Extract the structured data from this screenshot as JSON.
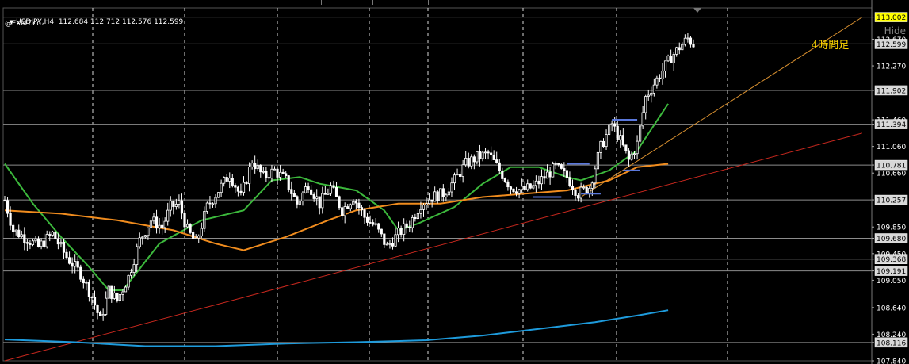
{
  "header": {
    "symbol": "USDJPY,H4",
    "ohlc": "112.684 112.712 112.576 112.599",
    "watermark": "@FXMT.co"
  },
  "hide_label": "Hide",
  "annotation": "4時間足",
  "colors": {
    "bg": "#000000",
    "grid": "#ffffff",
    "candles": "#ffffff",
    "ma_green": "#3cb83c",
    "ma_orange": "#f08c1e",
    "ma_blue": "#1e9bdc",
    "trend_red": "#c8281e",
    "trend_orange": "#d89030",
    "hline": "#8c8c8c",
    "level_blue": "#5a78dc",
    "price_tag_bg": "#ffffff",
    "price_tag_yellow": "#ffff00"
  },
  "chart_data": {
    "type": "candlestick",
    "title": "USDJPY,H4",
    "ylim": [
      107.84,
      113.14
    ],
    "y_ticks": [
      "113.002",
      "112.670",
      "112.599",
      "112.270",
      "111.902",
      "111.460",
      "111.394",
      "111.060",
      "110.781",
      "110.660",
      "110.257",
      "109.850",
      "109.680",
      "109.450",
      "109.368",
      "109.191",
      "109.050",
      "108.640",
      "108.240",
      "108.116",
      "107.840"
    ],
    "current_price": 112.599,
    "alert_price": 113.002,
    "horizontal_levels": [
      113.002,
      112.599,
      111.902,
      111.394,
      110.781,
      110.257,
      109.68,
      109.368,
      109.191,
      108.116
    ],
    "candle_count": 255,
    "close_path": [
      [
        0,
        110.25
      ],
      [
        3,
        109.8
      ],
      [
        7,
        109.7
      ],
      [
        12,
        109.55
      ],
      [
        17,
        109.75
      ],
      [
        22,
        109.4
      ],
      [
        27,
        109.15
      ],
      [
        31,
        108.8
      ],
      [
        34,
        108.45
      ],
      [
        37,
        108.9
      ],
      [
        40,
        108.75
      ],
      [
        44,
        109.1
      ],
      [
        48,
        109.65
      ],
      [
        52,
        109.95
      ],
      [
        56,
        109.85
      ],
      [
        59,
        110.15
      ],
      [
        62,
        110.2
      ],
      [
        65,
        109.8
      ],
      [
        68,
        109.6
      ],
      [
        72,
        110.15
      ],
      [
        76,
        110.4
      ],
      [
        80,
        110.65
      ],
      [
        84,
        110.3
      ],
      [
        88,
        110.85
      ],
      [
        92,
        110.6
      ],
      [
        96,
        110.7
      ],
      [
        100,
        110.55
      ],
      [
        104,
        110.2
      ],
      [
        108,
        110.5
      ],
      [
        112,
        110.2
      ],
      [
        116,
        110.45
      ],
      [
        120,
        110.1
      ],
      [
        124,
        110.3
      ],
      [
        128,
        110.0
      ],
      [
        132,
        109.85
      ],
      [
        136,
        109.55
      ],
      [
        140,
        109.75
      ],
      [
        144,
        109.9
      ],
      [
        148,
        110.2
      ],
      [
        152,
        110.3
      ],
      [
        156,
        110.35
      ],
      [
        160,
        110.55
      ],
      [
        164,
        110.8
      ],
      [
        168,
        110.9
      ],
      [
        172,
        110.95
      ],
      [
        176,
        110.7
      ],
      [
        180,
        110.45
      ],
      [
        184,
        110.4
      ],
      [
        188,
        110.45
      ],
      [
        192,
        110.6
      ],
      [
        196,
        110.75
      ],
      [
        200,
        110.6
      ],
      [
        204,
        110.35
      ],
      [
        208,
        110.45
      ],
      [
        212,
        111.05
      ],
      [
        216,
        111.4
      ],
      [
        219,
        111.15
      ],
      [
        222,
        110.85
      ],
      [
        225,
        111.1
      ],
      [
        228,
        111.8
      ],
      [
        231,
        112.0
      ],
      [
        234,
        112.2
      ],
      [
        237,
        112.4
      ],
      [
        240,
        112.55
      ],
      [
        243,
        112.68
      ],
      [
        245,
        112.6
      ]
    ],
    "series": [
      {
        "name": "",
        "color": "#3cb83c",
        "points": [
          [
            0,
            110.8
          ],
          [
            10,
            110.2
          ],
          [
            20,
            109.7
          ],
          [
            30,
            109.25
          ],
          [
            37,
            108.9
          ],
          [
            42,
            108.9
          ],
          [
            55,
            109.6
          ],
          [
            70,
            109.95
          ],
          [
            85,
            110.1
          ],
          [
            95,
            110.55
          ],
          [
            105,
            110.6
          ],
          [
            112,
            110.5
          ],
          [
            125,
            110.4
          ],
          [
            135,
            110.1
          ],
          [
            140,
            109.8
          ],
          [
            147,
            109.9
          ],
          [
            160,
            110.15
          ],
          [
            170,
            110.5
          ],
          [
            180,
            110.75
          ],
          [
            190,
            110.75
          ],
          [
            200,
            110.6
          ],
          [
            205,
            110.55
          ],
          [
            215,
            110.7
          ],
          [
            225,
            111.0
          ],
          [
            236,
            111.7
          ]
        ]
      },
      {
        "name": "",
        "color": "#f08c1e",
        "points": [
          [
            0,
            110.1
          ],
          [
            20,
            110.05
          ],
          [
            40,
            109.95
          ],
          [
            60,
            109.8
          ],
          [
            75,
            109.6
          ],
          [
            85,
            109.5
          ],
          [
            100,
            109.7
          ],
          [
            115,
            109.95
          ],
          [
            125,
            110.1
          ],
          [
            140,
            110.2
          ],
          [
            155,
            110.2
          ],
          [
            170,
            110.3
          ],
          [
            185,
            110.35
          ],
          [
            200,
            110.4
          ],
          [
            215,
            110.55
          ],
          [
            225,
            110.75
          ],
          [
            236,
            110.8
          ]
        ]
      },
      {
        "name": "",
        "color": "#1e9bdc",
        "points": [
          [
            0,
            108.16
          ],
          [
            25,
            108.12
          ],
          [
            50,
            108.06
          ],
          [
            75,
            108.06
          ],
          [
            100,
            108.1
          ],
          [
            125,
            108.12
          ],
          [
            150,
            108.15
          ],
          [
            170,
            108.22
          ],
          [
            190,
            108.32
          ],
          [
            210,
            108.42
          ],
          [
            225,
            108.52
          ],
          [
            236,
            108.6
          ]
        ]
      }
    ],
    "trend_lines": [
      {
        "color": "#c8281e",
        "from": [
          0,
          107.84
        ],
        "to": [
          305,
          111.26
        ]
      },
      {
        "color": "#d89030",
        "from": [
          205,
          110.3
        ],
        "to": [
          305,
          113.0
        ]
      }
    ],
    "level_marks": [
      {
        "from": 200,
        "to": 208,
        "price": 110.8
      },
      {
        "from": 216,
        "to": 225,
        "price": 111.46
      },
      {
        "from": 220,
        "to": 226,
        "price": 110.7
      },
      {
        "from": 205,
        "to": 212,
        "price": 110.35
      },
      {
        "from": 188,
        "to": 198,
        "price": 110.3
      }
    ]
  }
}
